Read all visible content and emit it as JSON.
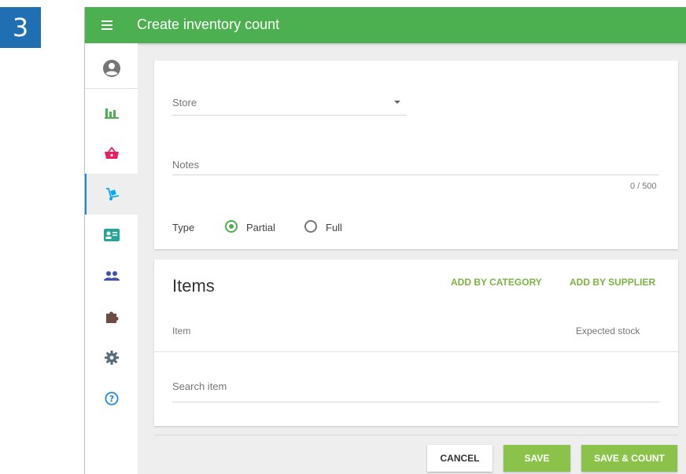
{
  "step_badge": "3",
  "header": {
    "title": "Create inventory count",
    "menu_icon": "menu-icon"
  },
  "sidebar": {
    "items": [
      {
        "icon": "account-circle-icon",
        "color": "#757575"
      },
      {
        "icon": "bar-chart-icon",
        "color": "#4caf50"
      },
      {
        "icon": "shopping-basket-icon",
        "color": "#e91e63"
      },
      {
        "icon": "dolly-icon",
        "color": "#03a9f4",
        "active": true
      },
      {
        "icon": "id-card-icon",
        "color": "#26a69a"
      },
      {
        "icon": "people-icon",
        "color": "#3f51b5"
      },
      {
        "icon": "puzzle-icon",
        "color": "#6d4c41"
      },
      {
        "icon": "gear-icon",
        "color": "#546e7a"
      },
      {
        "icon": "help-icon",
        "color": "#1e88e5"
      }
    ]
  },
  "form": {
    "store_label": "Store",
    "notes_label": "Notes",
    "notes_counter": "0 / 500",
    "type_label": "Type",
    "type_options": [
      "Partial",
      "Full"
    ],
    "type_selected": "Partial"
  },
  "items": {
    "title": "Items",
    "add_by_category": "ADD BY CATEGORY",
    "add_by_supplier": "ADD BY SUPPLIER",
    "col_item": "Item",
    "col_expected_stock": "Expected stock",
    "search_placeholder": "Search item"
  },
  "actions": {
    "cancel": "CANCEL",
    "save": "SAVE",
    "save_and_count": "SAVE & COUNT"
  },
  "colors": {
    "primary": "#4caf50",
    "accent": "#8bc34a",
    "link": "#7cb342",
    "badge": "#1f6fb2"
  }
}
